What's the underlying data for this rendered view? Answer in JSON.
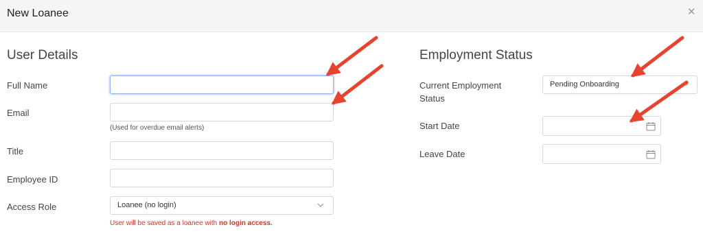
{
  "modal": {
    "title": "New Loanee",
    "close_icon": "close-icon"
  },
  "user_details": {
    "title": "User Details",
    "full_name": {
      "label": "Full Name",
      "value": "",
      "placeholder": ""
    },
    "email": {
      "label": "Email",
      "value": "",
      "placeholder": "",
      "help": "(Used for overdue email alerts)"
    },
    "title_field": {
      "label": "Title",
      "value": "",
      "placeholder": ""
    },
    "employee_id": {
      "label": "Employee ID",
      "value": "",
      "placeholder": ""
    },
    "access_role": {
      "label": "Access Role",
      "selected": "Loanee (no login)",
      "warning_prefix": "User will be saved as a loanee with ",
      "warning_bold": "no login access."
    }
  },
  "employment_status": {
    "title": "Employment Status",
    "current_status": {
      "label_line1": "Current Employment",
      "label_line2": "Status",
      "selected": "Pending Onboarding"
    },
    "start_date": {
      "label": "Start Date",
      "value": "",
      "icon": "calendar-icon"
    },
    "leave_date": {
      "label": "Leave Date",
      "value": "",
      "icon": "calendar-icon"
    }
  },
  "colors": {
    "annotation_arrow": "#e8432e",
    "warning_text": "#d9312a",
    "focus_border": "#8fb3e8",
    "header_bg": "#f5f5f5"
  }
}
